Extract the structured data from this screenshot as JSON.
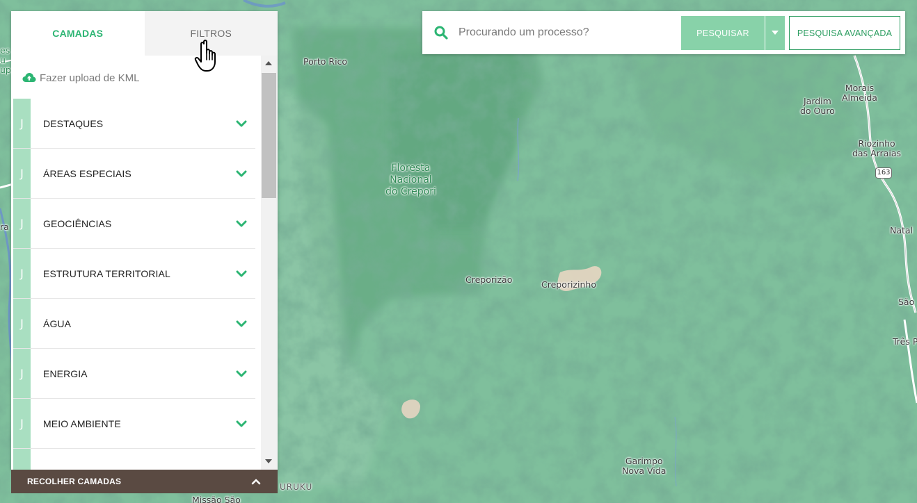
{
  "map": {
    "labels": [
      {
        "id": "porto-rico",
        "text": "Porto Rico"
      },
      {
        "id": "floresta",
        "text": "Floresta\nNacional\ndo Crepori"
      },
      {
        "id": "creporizao",
        "text": "Creporizão"
      },
      {
        "id": "creporizinho",
        "text": "Creporizinho"
      },
      {
        "id": "garimpo",
        "text": "Garimpo\nNova Vida"
      },
      {
        "id": "jardim-do-ouro",
        "text": "Jardim\ndo Ouro"
      },
      {
        "id": "morais-almeida",
        "text": "Morais\nAlmeida"
      },
      {
        "id": "riozinho",
        "text": "Riozinho\ndas Arraias"
      },
      {
        "id": "natal",
        "text": "Natal"
      },
      {
        "id": "sao",
        "text": "São"
      },
      {
        "id": "tres",
        "text": "Três P"
      },
      {
        "id": "missao-sao",
        "text": "Missão São"
      },
      {
        "id": "uruku",
        "text": "URUKU"
      },
      {
        "id": "left-edge-1",
        "text": "es\nu\nup"
      },
      {
        "id": "left-edge-2",
        "text": "ra"
      }
    ],
    "route_number": "163"
  },
  "panel": {
    "tabs": [
      {
        "label": "CAMADAS",
        "active": true
      },
      {
        "label": "FILTROS",
        "active": false
      }
    ],
    "upload_label": "Fazer upload de KML",
    "layers": [
      {
        "label": "DESTAQUES"
      },
      {
        "label": "ÁREAS ESPECIAIS"
      },
      {
        "label": "GEOCIÊNCIAS"
      },
      {
        "label": "ESTRUTURA TERRITORIAL"
      },
      {
        "label": "ÁGUA"
      },
      {
        "label": "ENERGIA"
      },
      {
        "label": "MEIO AMBIENTE"
      },
      {
        "label": ""
      }
    ],
    "handle_glyph": "J",
    "collapse_label": "RECOLHER CAMADAS"
  },
  "search": {
    "placeholder": "Procurando um processo?",
    "value": "",
    "search_button": "PESQUISAR",
    "advanced_button": "PESQUISA AVANÇADA"
  },
  "colors": {
    "accent": "#2cb573",
    "accent_light": "#88d2a9",
    "handle": "#a9dfc1",
    "collapse_bar": "#5a4a42",
    "map_base": "#7fbf9c"
  },
  "icons": {
    "search": "search-icon",
    "upload": "cloud-upload-icon",
    "chevron": "chevron-down-icon",
    "collapse": "chevron-up-icon",
    "cursor": "hand-pointer-icon"
  }
}
